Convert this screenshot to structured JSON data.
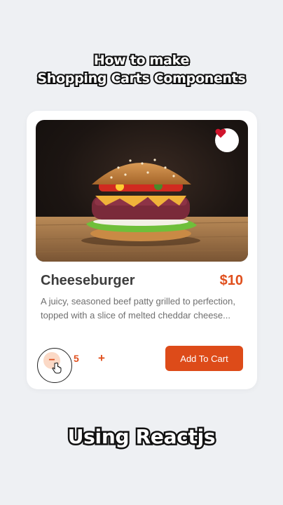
{
  "captions": {
    "line1": "How to make",
    "line2": "Shopping Carts Components",
    "bottom": "Using Reactjs"
  },
  "product": {
    "name": "Cheeseburger",
    "price": "$10",
    "description": "A juicy, seasoned beef patty grilled to perfection, topped with a slice of melted cheddar cheese...",
    "image_icon": "burger-image",
    "favorite_icon": "heart-icon"
  },
  "quantity": {
    "minus_label": "−",
    "value": "5",
    "plus_label": "+"
  },
  "actions": {
    "add_to_cart_label": "Add To Cart"
  },
  "colors": {
    "accent": "#dd4b19",
    "accent_light": "#fbd9c6",
    "heart": "#d0142c",
    "background": "#eef0f3"
  }
}
